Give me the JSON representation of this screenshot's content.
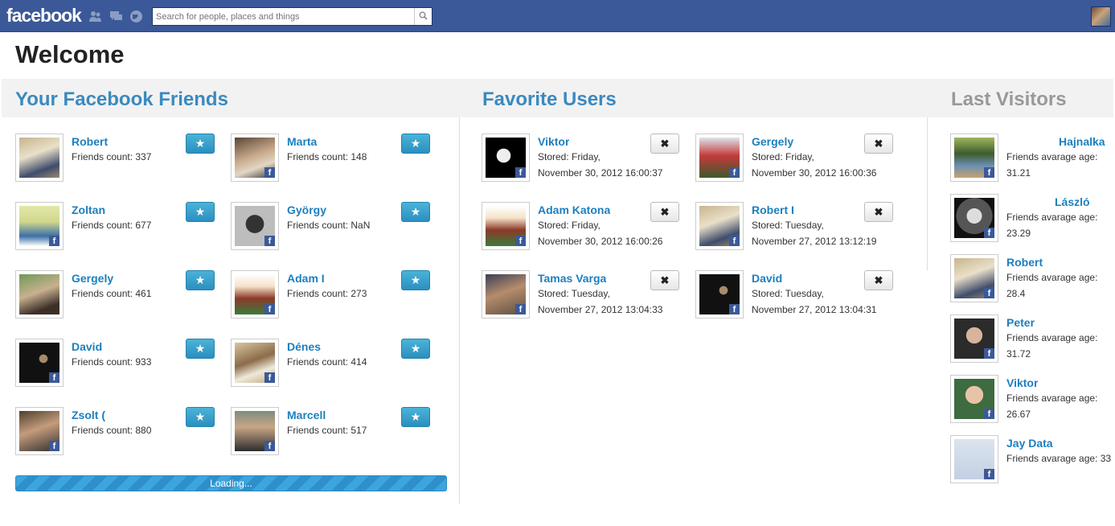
{
  "topbar": {
    "logo": "facebook",
    "search_placeholder": "Search for people, places and things"
  },
  "page_title": "Welcome",
  "sections": {
    "friends_title": "Your Facebook Friends",
    "favorites_title": "Favorite Users",
    "last_title": "Last Visitors"
  },
  "friends": [
    {
      "name": "Robert",
      "line": "Friends count: 337"
    },
    {
      "name": "Marta",
      "line": "Friends count: 148"
    },
    {
      "name": "Zoltan",
      "line": "Friends count: 677"
    },
    {
      "name": "György",
      "line": "Friends count: NaN"
    },
    {
      "name": "Gergely",
      "line": "Friends count: 461"
    },
    {
      "name": "Adam I",
      "line": "Friends count: 273"
    },
    {
      "name": "David",
      "line": "Friends count: 933"
    },
    {
      "name": "Dénes",
      "line": "Friends count: 414"
    },
    {
      "name": "Zsolt (",
      "line": "Friends count: 880"
    },
    {
      "name": "Marcell",
      "line": "Friends count: 517"
    }
  ],
  "star_glyph": "★",
  "remove_glyph": "✖",
  "loading_text": "Loading...",
  "favorites": [
    {
      "name": "Viktor",
      "stored": "Stored: Friday,",
      "date": "November 30, 2012 16:00:37"
    },
    {
      "name": "Gergely",
      "stored": "Stored: Friday,",
      "date": "November 30, 2012 16:00:36"
    },
    {
      "name": "Adam Katona",
      "stored": "Stored: Friday,",
      "date": "November 30, 2012 16:00:26"
    },
    {
      "name": "Robert I",
      "stored": "Stored: Tuesday,",
      "date": "November 27, 2012 13:12:19"
    },
    {
      "name": "Tamas Varga",
      "stored": "Stored: Tuesday,",
      "date": "November 27, 2012 13:04:33"
    },
    {
      "name": "David",
      "stored": "Stored: Tuesday,",
      "date": "November 27, 2012 13:04:31"
    }
  ],
  "visitors": [
    {
      "name": "Hajnalka",
      "label": "Friends avarage age:",
      "age": "31.21"
    },
    {
      "name": "László",
      "label": "Friends avarage age:",
      "age": "23.29"
    },
    {
      "name": "Robert",
      "label": "Friends avarage age:",
      "age": "28.4"
    },
    {
      "name": "Peter",
      "label": "Friends avarage age:",
      "age": "31.72"
    },
    {
      "name": "Viktor",
      "label": "Friends avarage age:",
      "age": "26.67"
    },
    {
      "name": "Jay Data",
      "label": "Friends avarage age: 33",
      "age": ""
    }
  ],
  "colors": {
    "topbar": "#3b5998",
    "link": "#1c7fbf",
    "section_title": "#3a8abf",
    "section_title_muted": "#999999",
    "star_button": "#3da5d6"
  },
  "icons": [
    "friends-jewel-icon",
    "messages-jewel-icon",
    "notifications-globe-icon",
    "search-icon",
    "star-icon",
    "close-icon",
    "facebook-badge-icon"
  ]
}
